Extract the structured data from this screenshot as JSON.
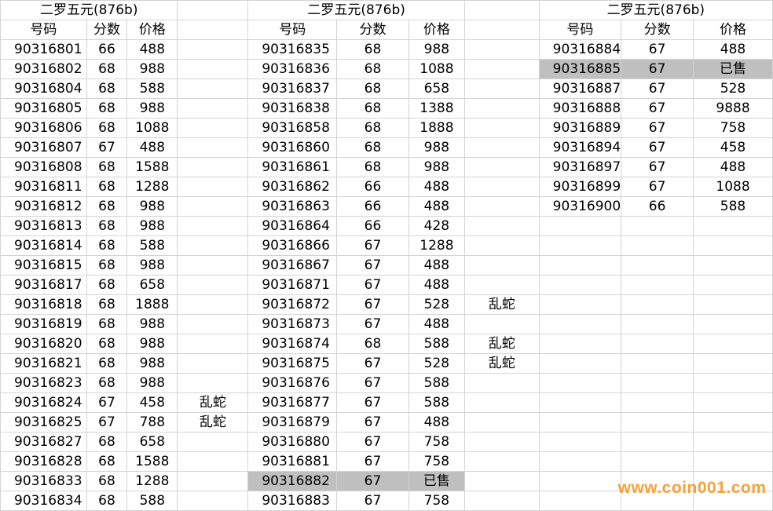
{
  "title": "二罗五元(876b)",
  "headers": {
    "code": "号码",
    "score": "分数",
    "price": "价格"
  },
  "left": [
    {
      "code": "90316801",
      "score": "66",
      "price": "488",
      "note": ""
    },
    {
      "code": "90316802",
      "score": "68",
      "price": "988",
      "note": ""
    },
    {
      "code": "90316804",
      "score": "68",
      "price": "588",
      "note": ""
    },
    {
      "code": "90316805",
      "score": "68",
      "price": "988",
      "note": ""
    },
    {
      "code": "90316806",
      "score": "68",
      "price": "1088",
      "note": ""
    },
    {
      "code": "90316807",
      "score": "67",
      "price": "488",
      "note": ""
    },
    {
      "code": "90316808",
      "score": "68",
      "price": "1588",
      "note": ""
    },
    {
      "code": "90316811",
      "score": "68",
      "price": "1288",
      "note": ""
    },
    {
      "code": "90316812",
      "score": "68",
      "price": "988",
      "note": ""
    },
    {
      "code": "90316813",
      "score": "68",
      "price": "988",
      "note": ""
    },
    {
      "code": "90316814",
      "score": "68",
      "price": "588",
      "note": ""
    },
    {
      "code": "90316815",
      "score": "68",
      "price": "988",
      "note": ""
    },
    {
      "code": "90316817",
      "score": "68",
      "price": "658",
      "note": ""
    },
    {
      "code": "90316818",
      "score": "68",
      "price": "1888",
      "note": ""
    },
    {
      "code": "90316819",
      "score": "68",
      "price": "988",
      "note": ""
    },
    {
      "code": "90316820",
      "score": "68",
      "price": "988",
      "note": ""
    },
    {
      "code": "90316821",
      "score": "68",
      "price": "988",
      "note": ""
    },
    {
      "code": "90316823",
      "score": "68",
      "price": "988",
      "note": ""
    },
    {
      "code": "90316824",
      "score": "67",
      "price": "458",
      "note": "乱蛇"
    },
    {
      "code": "90316825",
      "score": "67",
      "price": "788",
      "note": "乱蛇"
    },
    {
      "code": "90316827",
      "score": "68",
      "price": "658",
      "note": ""
    },
    {
      "code": "90316828",
      "score": "68",
      "price": "1588",
      "note": ""
    },
    {
      "code": "90316833",
      "score": "68",
      "price": "1288",
      "note": ""
    },
    {
      "code": "90316834",
      "score": "68",
      "price": "588",
      "note": ""
    }
  ],
  "middle": [
    {
      "code": "90316835",
      "score": "68",
      "price": "988",
      "note": ""
    },
    {
      "code": "90316836",
      "score": "68",
      "price": "1088",
      "note": ""
    },
    {
      "code": "90316837",
      "score": "68",
      "price": "658",
      "note": ""
    },
    {
      "code": "90316838",
      "score": "68",
      "price": "1388",
      "note": ""
    },
    {
      "code": "90316858",
      "score": "68",
      "price": "1888",
      "note": ""
    },
    {
      "code": "90316860",
      "score": "68",
      "price": "988",
      "note": ""
    },
    {
      "code": "90316861",
      "score": "68",
      "price": "988",
      "note": ""
    },
    {
      "code": "90316862",
      "score": "66",
      "price": "488",
      "note": ""
    },
    {
      "code": "90316863",
      "score": "66",
      "price": "488",
      "note": ""
    },
    {
      "code": "90316864",
      "score": "66",
      "price": "428",
      "note": ""
    },
    {
      "code": "90316866",
      "score": "67",
      "price": "1288",
      "note": ""
    },
    {
      "code": "90316867",
      "score": "67",
      "price": "488",
      "note": ""
    },
    {
      "code": "90316871",
      "score": "67",
      "price": "488",
      "note": ""
    },
    {
      "code": "90316872",
      "score": "67",
      "price": "528",
      "note": "乱蛇"
    },
    {
      "code": "90316873",
      "score": "67",
      "price": "488",
      "note": ""
    },
    {
      "code": "90316874",
      "score": "68",
      "price": "588",
      "note": "乱蛇"
    },
    {
      "code": "90316875",
      "score": "67",
      "price": "528",
      "note": "乱蛇"
    },
    {
      "code": "90316876",
      "score": "67",
      "price": "588",
      "note": ""
    },
    {
      "code": "90316877",
      "score": "67",
      "price": "588",
      "note": ""
    },
    {
      "code": "90316879",
      "score": "67",
      "price": "488",
      "note": ""
    },
    {
      "code": "90316880",
      "score": "67",
      "price": "758",
      "note": ""
    },
    {
      "code": "90316881",
      "score": "67",
      "price": "758",
      "note": ""
    },
    {
      "code": "90316882",
      "score": "67",
      "price": "已售",
      "note": "",
      "sold": true
    },
    {
      "code": "90316883",
      "score": "67",
      "price": "758",
      "note": ""
    }
  ],
  "right": [
    {
      "code": "90316884",
      "score": "67",
      "price": "488"
    },
    {
      "code": "90316885",
      "score": "67",
      "price": "已售",
      "sold": true
    },
    {
      "code": "90316887",
      "score": "67",
      "price": "528"
    },
    {
      "code": "90316888",
      "score": "67",
      "price": "9888"
    },
    {
      "code": "90316889",
      "score": "67",
      "price": "758"
    },
    {
      "code": "90316894",
      "score": "67",
      "price": "458"
    },
    {
      "code": "90316897",
      "score": "67",
      "price": "488"
    },
    {
      "code": "90316899",
      "score": "67",
      "price": "1088"
    },
    {
      "code": "90316900",
      "score": "66",
      "price": "588"
    }
  ],
  "watermark": "www.coin001.com"
}
